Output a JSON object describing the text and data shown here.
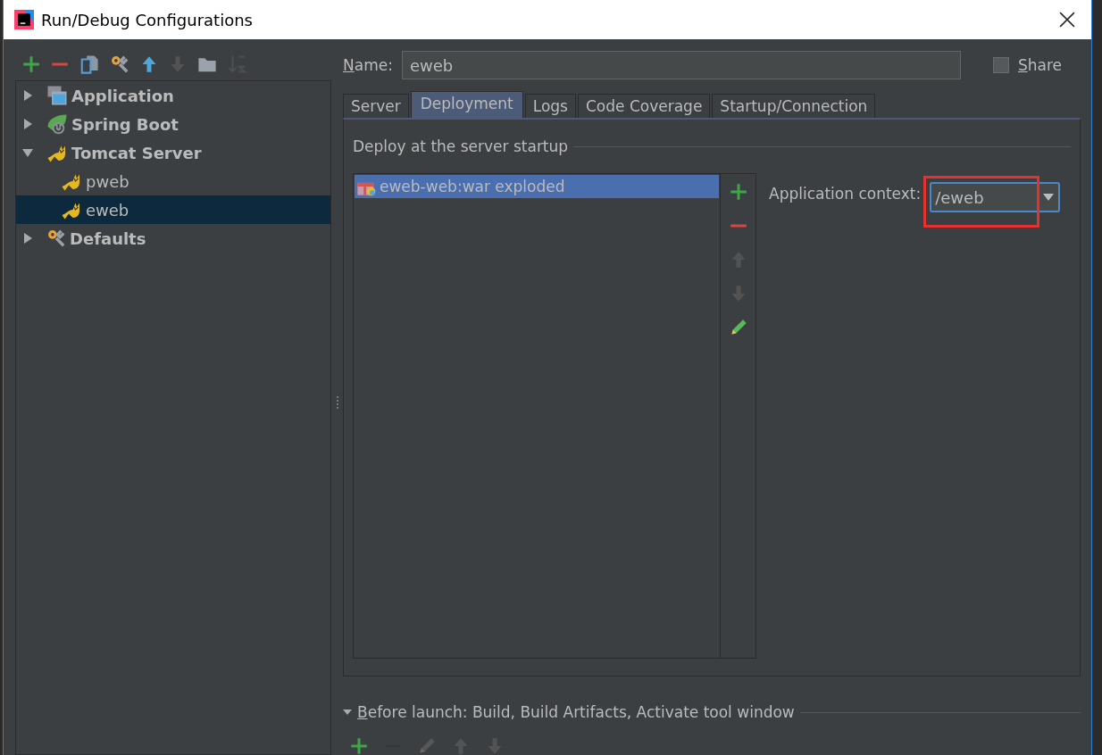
{
  "window": {
    "title": "Run/Debug Configurations"
  },
  "toolbar": [
    {
      "kind": "add",
      "disabled": false
    },
    {
      "kind": "remove",
      "disabled": false
    },
    {
      "kind": "copy",
      "disabled": false
    },
    {
      "kind": "wrench",
      "disabled": false
    },
    {
      "kind": "up",
      "disabled": false
    },
    {
      "kind": "down",
      "disabled": true
    },
    {
      "kind": "folder",
      "disabled": false
    },
    {
      "kind": "sort",
      "disabled": true
    }
  ],
  "tree": [
    {
      "label": "Application",
      "kind": "application",
      "expanded": false,
      "selected": false
    },
    {
      "label": "Spring Boot",
      "kind": "spring",
      "expanded": false,
      "selected": false
    },
    {
      "label": "Tomcat Server",
      "kind": "tomcat",
      "expanded": true,
      "selected": false,
      "children": [
        {
          "label": "pweb",
          "kind": "tomcat",
          "selected": false
        },
        {
          "label": "eweb",
          "kind": "tomcat",
          "selected": true
        }
      ]
    },
    {
      "label": "Defaults",
      "kind": "wrench",
      "expanded": false,
      "selected": false
    }
  ],
  "name_field": {
    "label": "Name:",
    "value": "eweb"
  },
  "share": {
    "label": "Share",
    "checked": false
  },
  "tabs": [
    {
      "label": "Server",
      "selected": false
    },
    {
      "label": "Deployment",
      "selected": true
    },
    {
      "label": "Logs",
      "selected": false
    },
    {
      "label": "Code Coverage",
      "selected": false
    },
    {
      "label": "Startup/Connection",
      "selected": false
    }
  ],
  "deployment": {
    "section_title": "Deploy at the server startup",
    "artifacts": [
      {
        "label": "eweb-web:war exploded",
        "selected": true
      }
    ],
    "side_buttons": [
      {
        "kind": "add",
        "disabled": false
      },
      {
        "kind": "remove",
        "disabled": false
      },
      {
        "kind": "up",
        "disabled": true
      },
      {
        "kind": "down",
        "disabled": true
      },
      {
        "kind": "edit",
        "disabled": false
      }
    ],
    "context": {
      "label": "Application context:",
      "value": "/eweb",
      "highlighted": true
    }
  },
  "before_launch": {
    "title": "Before launch: Build, Build Artifacts, Activate tool window",
    "expanded": true,
    "buttons": [
      {
        "kind": "add",
        "disabled": false
      },
      {
        "kind": "remove",
        "disabled": true
      },
      {
        "kind": "edit",
        "disabled": true
      },
      {
        "kind": "up",
        "disabled": true
      },
      {
        "kind": "down",
        "disabled": true
      }
    ]
  }
}
